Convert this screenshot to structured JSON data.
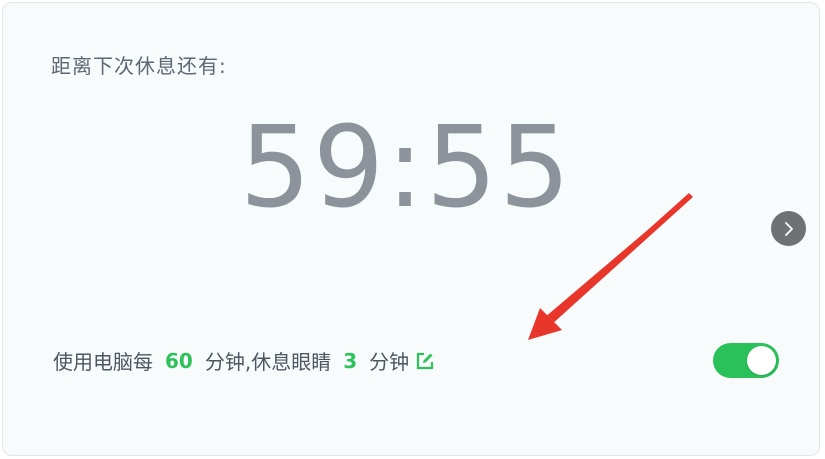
{
  "panel": {
    "heading": "距离下次休息还有:",
    "countdown": "59:55"
  },
  "settings": {
    "prefix": "使用电脑每",
    "work_minutes": "60",
    "mid": "分钟,休息眼睛",
    "rest_minutes": "3",
    "suffix": "分钟",
    "enabled": true
  },
  "colors": {
    "accent": "#2fc25b",
    "toggle_on": "#2ac15a",
    "timer_text": "#8c939b",
    "annotation_arrow": "#e8362b"
  },
  "icons": {
    "edit": "edit-icon",
    "next": "chevron-right-icon"
  }
}
